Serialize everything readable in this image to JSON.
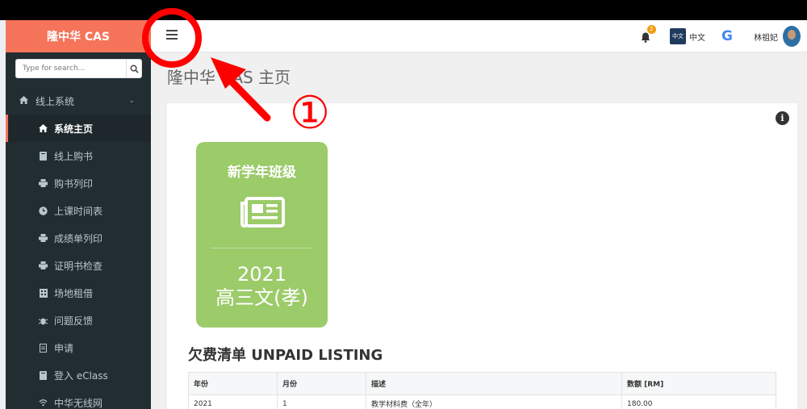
{
  "app": {
    "logo": "隆中华 CAS"
  },
  "search": {
    "placeholder": "Type for search..."
  },
  "sidebar": {
    "section": "线上系统",
    "items": [
      {
        "label": "系统主页",
        "icon": "home-icon",
        "active": true
      },
      {
        "label": "线上购书",
        "icon": "book-icon"
      },
      {
        "label": "购书列印",
        "icon": "print-icon"
      },
      {
        "label": "上课时间表",
        "icon": "clock-icon"
      },
      {
        "label": "成绩单列印",
        "icon": "print-icon"
      },
      {
        "label": "证明书检查",
        "icon": "print-icon"
      },
      {
        "label": "场地租借",
        "icon": "building-icon"
      },
      {
        "label": "问题反馈",
        "icon": "bug-icon"
      },
      {
        "label": "申请",
        "icon": "file-icon"
      },
      {
        "label": "登入 eClass",
        "icon": "book-icon"
      },
      {
        "label": "中华无线网",
        "icon": "wifi-icon"
      }
    ]
  },
  "header": {
    "notification_count": "2",
    "lang_icon_text": "中文",
    "lang_label": "中文",
    "google_label": "G",
    "user_name": "林祖妃"
  },
  "page": {
    "title": "隆中华 CAS 主页"
  },
  "card": {
    "title": "新学年班级",
    "year": "2021",
    "class_name": "高三文(孝)",
    "color": "#9ccb6a"
  },
  "unpaid": {
    "title": "欠费清单 UNPAID LISTING",
    "columns": [
      "年份",
      "月份",
      "描述",
      "数额 [RM]"
    ],
    "rows": [
      [
        "2021",
        "1",
        "教学材料费（全年）",
        "180.00"
      ]
    ]
  },
  "annotation": {
    "marker": "①",
    "color": "#ff0000"
  },
  "colors": {
    "accent": "#f5745a",
    "sidebar": "#222d32"
  }
}
